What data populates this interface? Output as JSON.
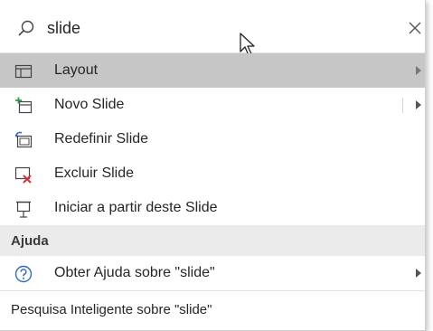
{
  "search": {
    "value": "slide"
  },
  "items": [
    {
      "label": "Layout",
      "icon": "layout-icon",
      "submenu": true,
      "active": true
    },
    {
      "label": "Novo Slide",
      "icon": "new-slide-icon",
      "submenu": true,
      "active": false
    },
    {
      "label": "Redefinir Slide",
      "icon": "reset-slide-icon",
      "submenu": false,
      "active": false
    },
    {
      "label": "Excluir Slide",
      "icon": "delete-slide-icon",
      "submenu": false,
      "active": false
    },
    {
      "label": "Iniciar a partir deste Slide",
      "icon": "start-from-slide-icon",
      "submenu": false,
      "active": false
    }
  ],
  "help_section": {
    "title": "Ajuda",
    "item": {
      "label": "Obter Ajuda sobre \"slide\"",
      "icon": "help-icon"
    }
  },
  "footer": {
    "label": "Pesquisa Inteligente sobre \"slide\""
  },
  "colors": {
    "active_bg": "#c6c6c6",
    "section_bg": "#ebebeb",
    "help_blue": "#2b6cc4",
    "delete_red": "#d13438",
    "new_green": "#2e9e3e"
  }
}
